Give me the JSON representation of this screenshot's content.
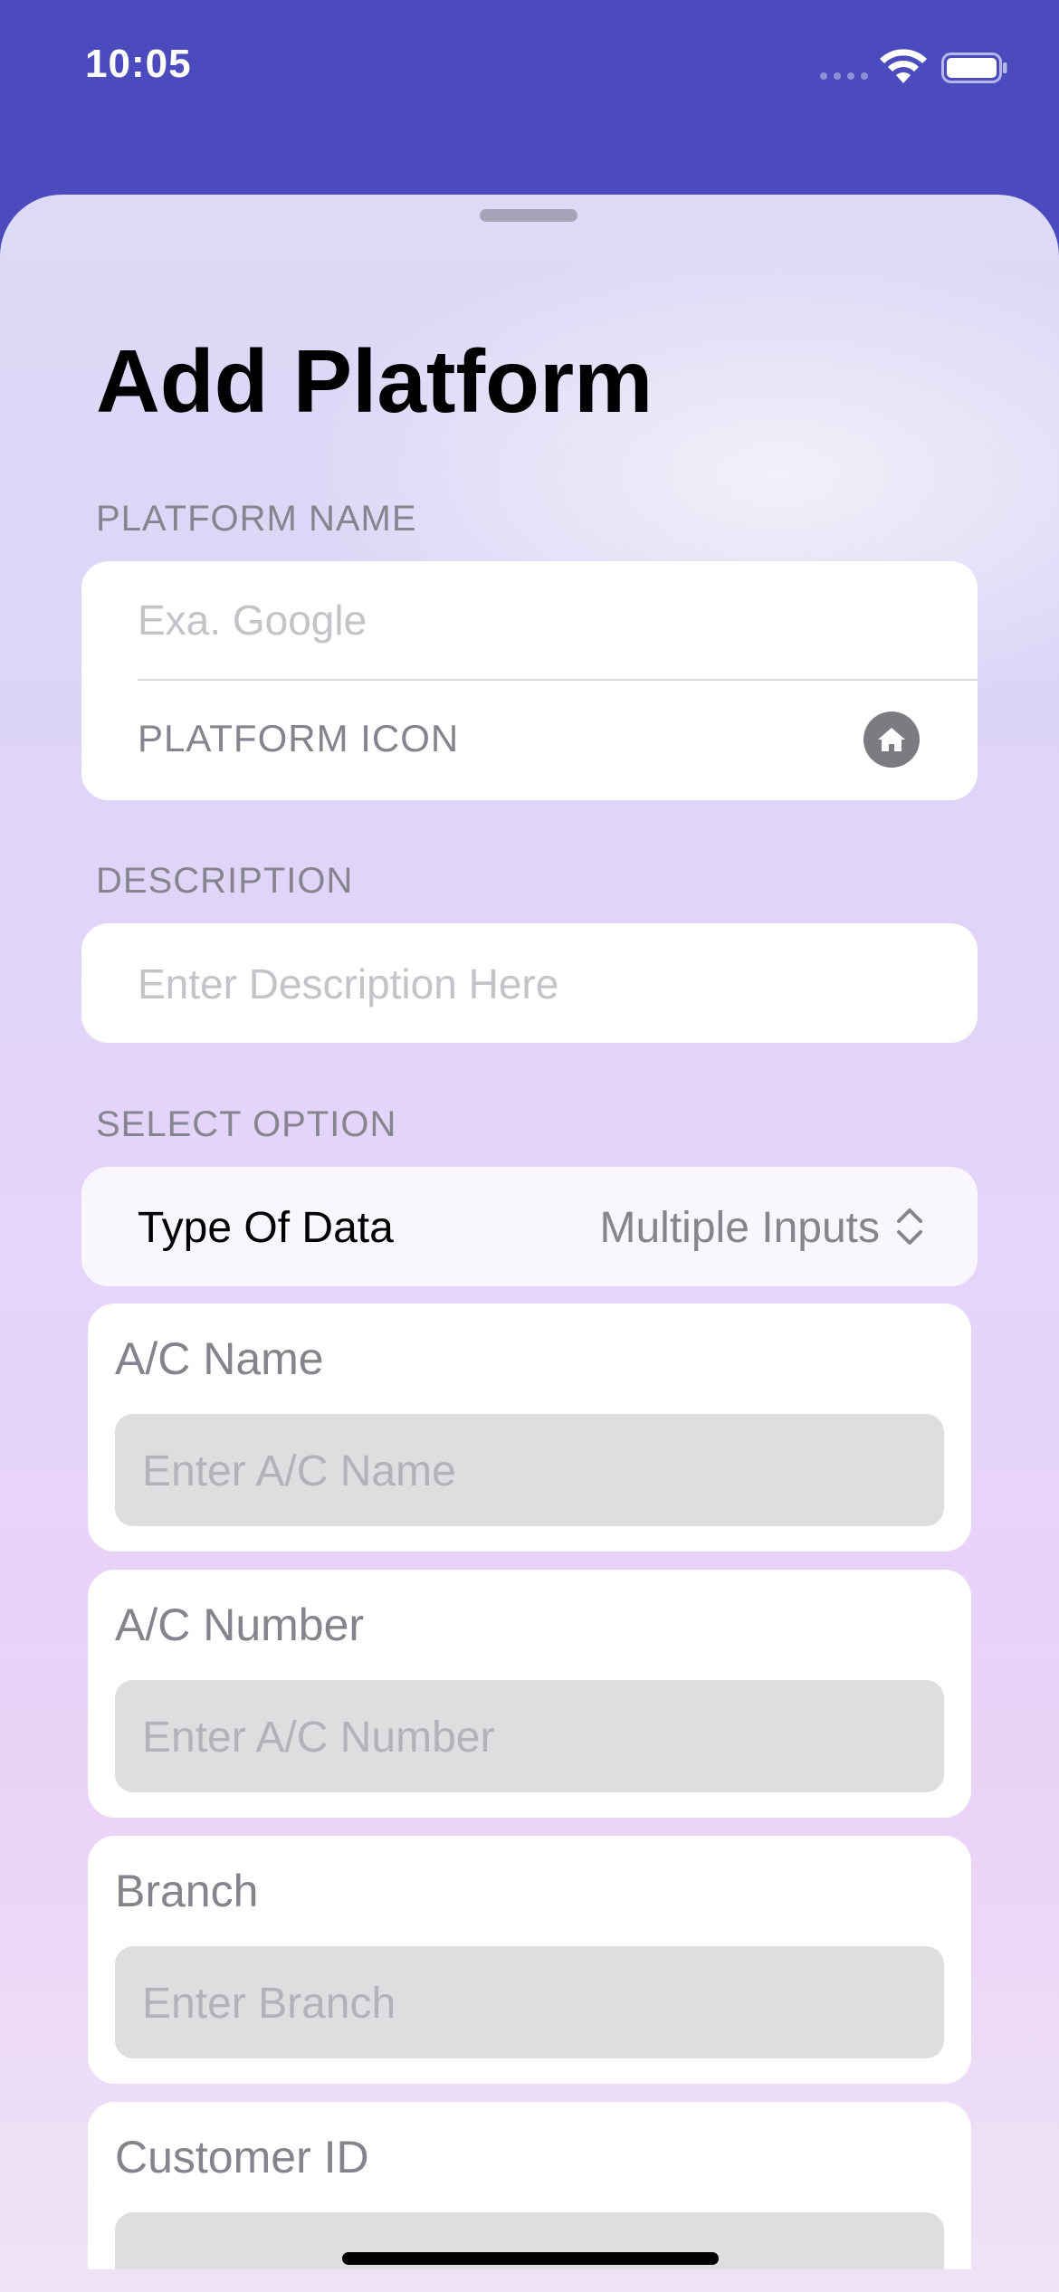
{
  "status_bar": {
    "time": "10:05",
    "icons": [
      "cellular-signal-icon",
      "wifi-icon",
      "battery-icon"
    ]
  },
  "sheet": {
    "title": "Add Platform",
    "platform_name": {
      "section_label": "PLATFORM NAME",
      "placeholder": "Exa. Google",
      "icon_row_label": "PLATFORM ICON",
      "icon": "house-icon"
    },
    "description": {
      "section_label": "DESCRIPTION",
      "placeholder": "Enter Description Here"
    },
    "select_option": {
      "section_label": "SELECT OPTION",
      "label": "Type Of Data",
      "value": "Multiple Inputs",
      "icon": "chevron-up-down-icon"
    },
    "fields": [
      {
        "label": "A/C Name",
        "placeholder": "Enter A/C Name"
      },
      {
        "label": "A/C Number",
        "placeholder": "Enter A/C Number"
      },
      {
        "label": "Branch",
        "placeholder": "Enter Branch"
      },
      {
        "label": "Customer ID",
        "placeholder": ""
      }
    ]
  },
  "colors": {
    "header_background": "#4b4bbd",
    "card_background": "#ffffff",
    "input_fill": "#dedddf"
  }
}
